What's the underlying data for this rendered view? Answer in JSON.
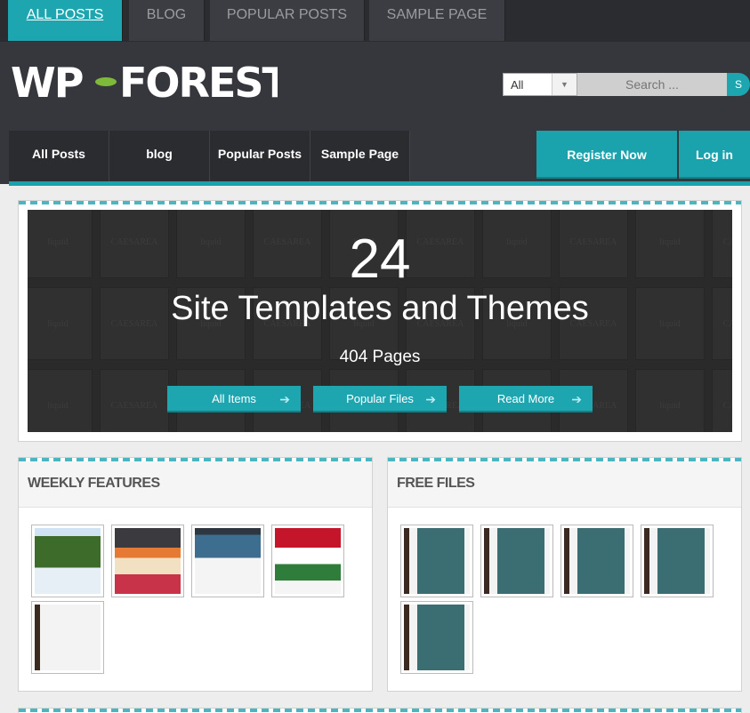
{
  "top_tabs": [
    "ALL POSTS",
    "BLOG",
    "POPULAR POSTS",
    "SAMPLE PAGE"
  ],
  "logo_text": "WP-FOREST",
  "search": {
    "category_value": "All",
    "placeholder": "Search ...",
    "button_label": "S"
  },
  "nav": [
    "All Posts",
    "blog",
    "Popular Posts",
    "Sample Page"
  ],
  "auth": {
    "register_label": "Register Now",
    "login_label": "Log in"
  },
  "hero": {
    "count": "24",
    "title": "Site Templates and Themes",
    "pages": "404 Pages",
    "buttons": [
      "All Items",
      "Popular Files",
      "Read More"
    ],
    "arrow_icon": "➔",
    "tile_words": [
      "liquid",
      "CAESAREA",
      "liquid",
      "CAESAREA",
      "liquid",
      "CAESAREA",
      "liquid",
      "CAESAREA",
      "liquid",
      "CAESAREA"
    ]
  },
  "panels": {
    "weekly": {
      "title": "WEEKLY FEATURES"
    },
    "free": {
      "title": "FREE FILES"
    }
  },
  "colors": {
    "accent": "#1ea6b0",
    "dark": "#35373c"
  }
}
